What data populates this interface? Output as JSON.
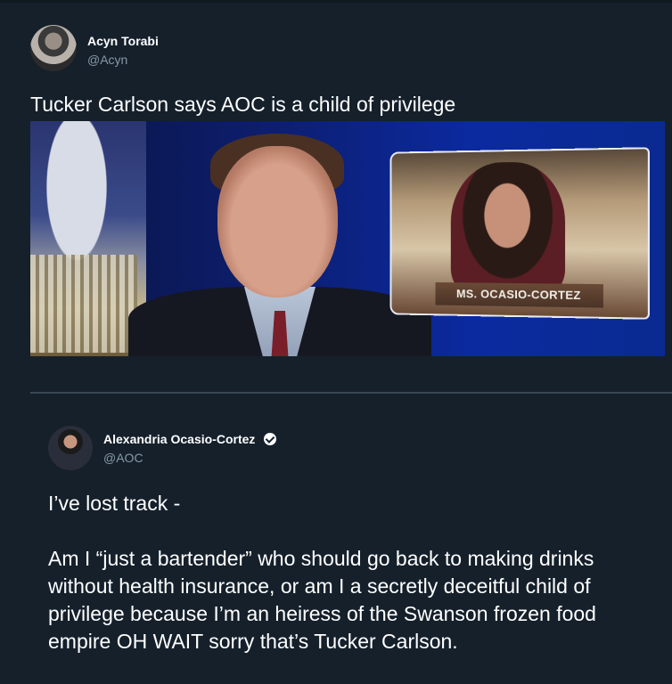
{
  "tweet1": {
    "name": "Acyn Torabi",
    "handle": "@Acyn",
    "text": "Tucker Carlson says AOC is a child of privilege",
    "media": {
      "inset_nameplate": "MS. OCASIO-CORTEZ"
    }
  },
  "tweet2": {
    "name": "Alexandria Ocasio-Cortez",
    "handle": "@AOC",
    "text_line1": "I’ve lost track -",
    "text_line2": "Am I “just a bartender” who should go back to making drinks without health insurance, or am I a secretly deceitful child of privilege because I’m an heiress of the Swanson frozen food empire OH WAIT sorry that’s Tucker Carlson."
  },
  "colors": {
    "background": "#15202b",
    "text": "#ffffff",
    "secondary_text": "#8899a6",
    "divider": "#3a4754"
  },
  "icons": {
    "verified": "verified-badge-icon"
  }
}
